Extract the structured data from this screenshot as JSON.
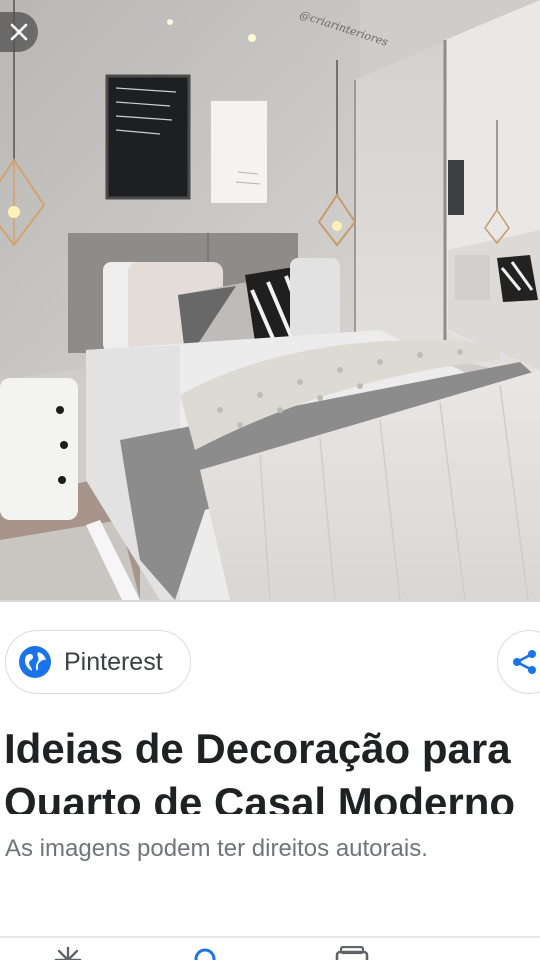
{
  "viewer": {
    "watermark": "@criarinteriores",
    "close_icon": "close-icon"
  },
  "source": {
    "name": "Pinterest",
    "icon": "globe-icon",
    "icon_color": "#1a73e8"
  },
  "share": {
    "icon": "share-icon",
    "icon_color": "#1a73e8"
  },
  "result": {
    "title": "Ideias de Decoração para Quarto de Casal Moderno",
    "copyright_notice": "As imagens podem ter direitos autorais."
  },
  "bottom_nav": {
    "items": [
      {
        "icon": "discover-icon"
      },
      {
        "icon": "search-icon",
        "active": true,
        "color": "#1a73e8"
      },
      {
        "icon": "collections-icon"
      }
    ]
  }
}
